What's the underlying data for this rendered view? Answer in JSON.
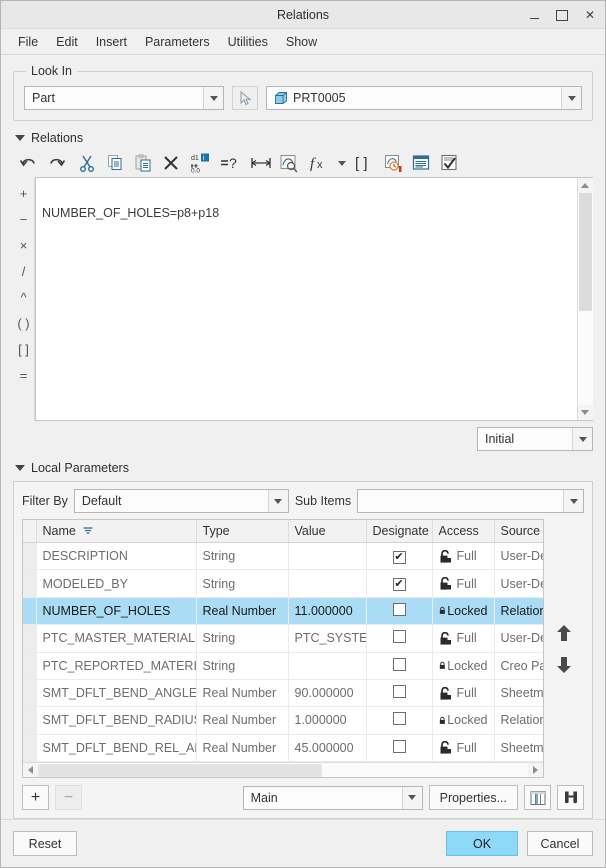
{
  "window": {
    "title": "Relations",
    "minimize_label": "Minimize",
    "maximize_label": "Maximize",
    "close_label": "✕"
  },
  "menu": {
    "items": [
      {
        "label": "File"
      },
      {
        "label": "Edit"
      },
      {
        "label": "Insert"
      },
      {
        "label": "Parameters"
      },
      {
        "label": "Utilities"
      },
      {
        "label": "Show"
      }
    ]
  },
  "look_in": {
    "group_title": "Look In",
    "scope": {
      "value": "Part"
    },
    "picker_icon": "select-arrow-icon",
    "object": {
      "value": "PRT0005",
      "icon": "part-cube-icon"
    }
  },
  "relations": {
    "section_title": "Relations",
    "toolbar": [
      {
        "name": "undo-button",
        "label": "Undo"
      },
      {
        "name": "redo-button",
        "label": "Redo"
      },
      {
        "name": "cut-button",
        "label": "Cut"
      },
      {
        "name": "copy-button",
        "label": "Copy"
      },
      {
        "name": "paste-button",
        "label": "Paste"
      },
      {
        "name": "delete-button",
        "label": "Delete"
      },
      {
        "name": "switch-dimensions-button",
        "label": "Switch Dimensions"
      },
      {
        "name": "evaluate-button",
        "label": "=?"
      },
      {
        "name": "insert-dimension-button",
        "label": "Insert Dimension"
      },
      {
        "name": "relations-from-model-button",
        "label": "Relations from Model"
      },
      {
        "name": "functions-button",
        "label": "fx"
      },
      {
        "name": "units-button",
        "label": "( )"
      },
      {
        "name": "history-button",
        "label": "History"
      },
      {
        "name": "parameters-list-button",
        "label": "Parameters"
      },
      {
        "name": "verify-button",
        "label": "Verify"
      }
    ],
    "operators": [
      "+",
      "−",
      "×",
      "/",
      "^",
      "( )",
      "[ ]",
      "="
    ],
    "editor_text": "NUMBER_OF_HOLES=p8+p18",
    "state_combo": {
      "value": "Initial"
    }
  },
  "local_parameters": {
    "section_title": "Local Parameters",
    "filter_label": "Filter By",
    "filter_value": "Default",
    "sub_items_label": "Sub Items",
    "sub_items_value": "",
    "columns": [
      "Name",
      "Type",
      "Value",
      "Designate",
      "Access",
      "Source"
    ],
    "rows": [
      {
        "name": "DESCRIPTION",
        "type": "String",
        "value": "",
        "designate": true,
        "access": "Full",
        "access_lock": "unlocked",
        "source": "User-Defin",
        "selected": false,
        "value_bold": false
      },
      {
        "name": "MODELED_BY",
        "type": "String",
        "value": "",
        "designate": true,
        "access": "Full",
        "access_lock": "unlocked",
        "source": "User-Defin",
        "selected": false,
        "value_bold": false
      },
      {
        "name": "NUMBER_OF_HOLES",
        "type": "Real Number",
        "value": "11.000000",
        "designate": false,
        "access": "Locked",
        "access_lock": "locked",
        "source": "Relation",
        "selected": true,
        "value_bold": false
      },
      {
        "name": "PTC_MASTER_MATERIAL",
        "type": "String",
        "value": "PTC_SYSTEM",
        "designate": false,
        "access": "Full",
        "access_lock": "unlocked",
        "source": "User-Defin",
        "selected": false,
        "value_bold": true
      },
      {
        "name": "PTC_REPORTED_MATERIAL",
        "type": "String",
        "value": "",
        "designate": false,
        "access": "Locked",
        "access_lock": "locked",
        "source": "Creo Param",
        "selected": false,
        "value_bold": false
      },
      {
        "name": "SMT_DFLT_BEND_ANGLE",
        "type": "Real Number",
        "value": "90.000000",
        "designate": false,
        "access": "Full",
        "access_lock": "unlocked",
        "source": "Sheetmeta",
        "selected": false,
        "value_bold": true
      },
      {
        "name": "SMT_DFLT_BEND_RADIUS",
        "type": "Real Number",
        "value": "1.000000",
        "designate": false,
        "access": "Locked",
        "access_lock": "locked",
        "source": "Relation",
        "selected": false,
        "value_bold": false
      },
      {
        "name": "SMT_DFLT_BEND_REL_ANGLE",
        "type": "Real Number",
        "value": "45.000000",
        "designate": false,
        "access": "Full",
        "access_lock": "unlocked",
        "source": "Sheetmeta",
        "selected": false,
        "value_bold": true
      }
    ],
    "add_label": "+",
    "remove_label": "−",
    "main_combo_value": "Main",
    "properties_label": "Properties...",
    "columns_button": "columns-icon",
    "find_button": "binoculars-icon"
  },
  "footer": {
    "reset_label": "Reset",
    "ok_label": "OK",
    "cancel_label": "Cancel"
  },
  "colors": {
    "selection": "#aadcf5",
    "ok_button": "#8ed8f8",
    "accent": "#1f6fa8"
  }
}
